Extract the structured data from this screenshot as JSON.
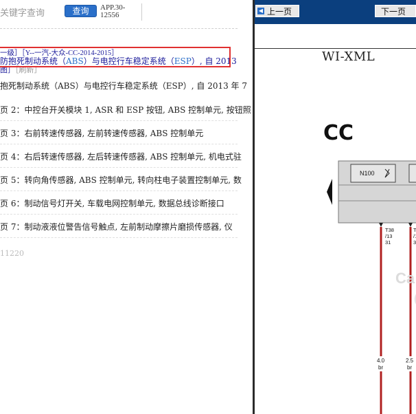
{
  "search": {
    "placeholder_text": "关键字查询",
    "button_label": "查询",
    "app_code_line1": "APP.30-",
    "app_code_line2": "12556"
  },
  "result": {
    "path": "一级］［Y--一汽-大众-CC-2014-2015］",
    "title_part1": "防抱死制动系统（",
    "title_abs": "ABS",
    "title_part2": "）与电控行车稳定系统（",
    "title_esp": "ESP",
    "title_part3": "）, 自 2013",
    "update_text": "图］",
    "update_tag": "［刷新］",
    "subtitle": "抱死制动系统（ABS）与电控行车稳定系统（ESP）, 自 2013 年 7"
  },
  "pages": [
    {
      "label": "页 2：",
      "text": "中控台开关模块 1, ASR 和 ESP 按钮, ABS 控制单元, 按钮照"
    },
    {
      "label": "页 3：",
      "text": "右前转速传感器, 左前转速传感器, ABS 控制单元"
    },
    {
      "label": "页 4：",
      "text": "右后转速传感器, 左后转速传感器, ABS 控制单元, 机电式驻"
    },
    {
      "label": "页 5：",
      "text": "转向角传感器, ABS 控制单元, 转向柱电子装置控制单元, 数"
    },
    {
      "label": "页 6：",
      "text": "制动信号灯开关, 车载电网控制单元, 数据总线诊断接口"
    },
    {
      "label": "页 7：",
      "text": "制动液液位警告信号触点, 左前制动摩擦片磨损传感器, 仪"
    }
  ],
  "footer_code": "11220",
  "viewer": {
    "prev_label": "上一页",
    "next_label": "下一页",
    "doc_header": "WI-XML",
    "model": "CC",
    "component": "N100",
    "wire1_label": "T38\n/13\n31",
    "wire2_label": "T\n/1\n3",
    "wire1_spec": "4.0\nbr",
    "wire2_spec": "2.5\nbr",
    "watermark": "Ca",
    "colors": {
      "wire": "#b02020",
      "topbar": "#0b3f7e",
      "button": "#2a6fc9",
      "highlight": "#e03030"
    }
  }
}
